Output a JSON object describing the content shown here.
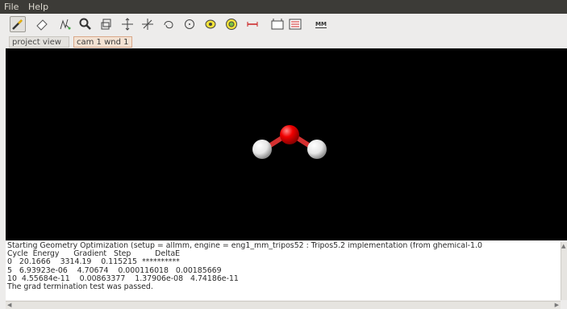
{
  "menu": {
    "file": "File",
    "help": "Help"
  },
  "toolbar": {
    "tools": [
      {
        "icon": "draw-icon",
        "active": true
      },
      {
        "icon": "eraser-icon"
      },
      {
        "icon": "select-icon"
      },
      {
        "icon": "zoom-icon"
      },
      {
        "icon": "clipping-icon"
      },
      {
        "icon": "translate-xy-icon"
      },
      {
        "icon": "translate-z-icon"
      },
      {
        "icon": "orbit-object-icon"
      },
      {
        "icon": "rotate-xy-icon"
      },
      {
        "icon": "orbit-world-icon"
      },
      {
        "icon": "rotate-world-icon"
      },
      {
        "icon": "measure-icon"
      },
      {
        "icon": "element-icon"
      },
      {
        "icon": "bond-type-icon"
      },
      {
        "icon": "mm-settings-icon",
        "label": "MM"
      }
    ]
  },
  "tabs": {
    "project_view": "project view",
    "cam_window": "cam 1 wnd 1"
  },
  "console": {
    "lines": [
      "Starting Geometry Optimization (setup = allmm, engine = eng1_mm_tripos52 : Tripos5.2 implementation (from ghemical-1.0",
      "Cycle  Energy      Gradient   Step          DeltaE",
      "0   20.1666    3314.19    0.115215  **********",
      "5   6.93923e-06    4.70674    0.000116018   0.00185669",
      "10  4.55684e-11    0.00863377    1.37906e-08   4.74186e-11",
      "The grad termination test was passed."
    ]
  },
  "colors": {
    "oxygen": "#e00000",
    "hydrogen": "#f0f0f0",
    "background": "#000000"
  }
}
